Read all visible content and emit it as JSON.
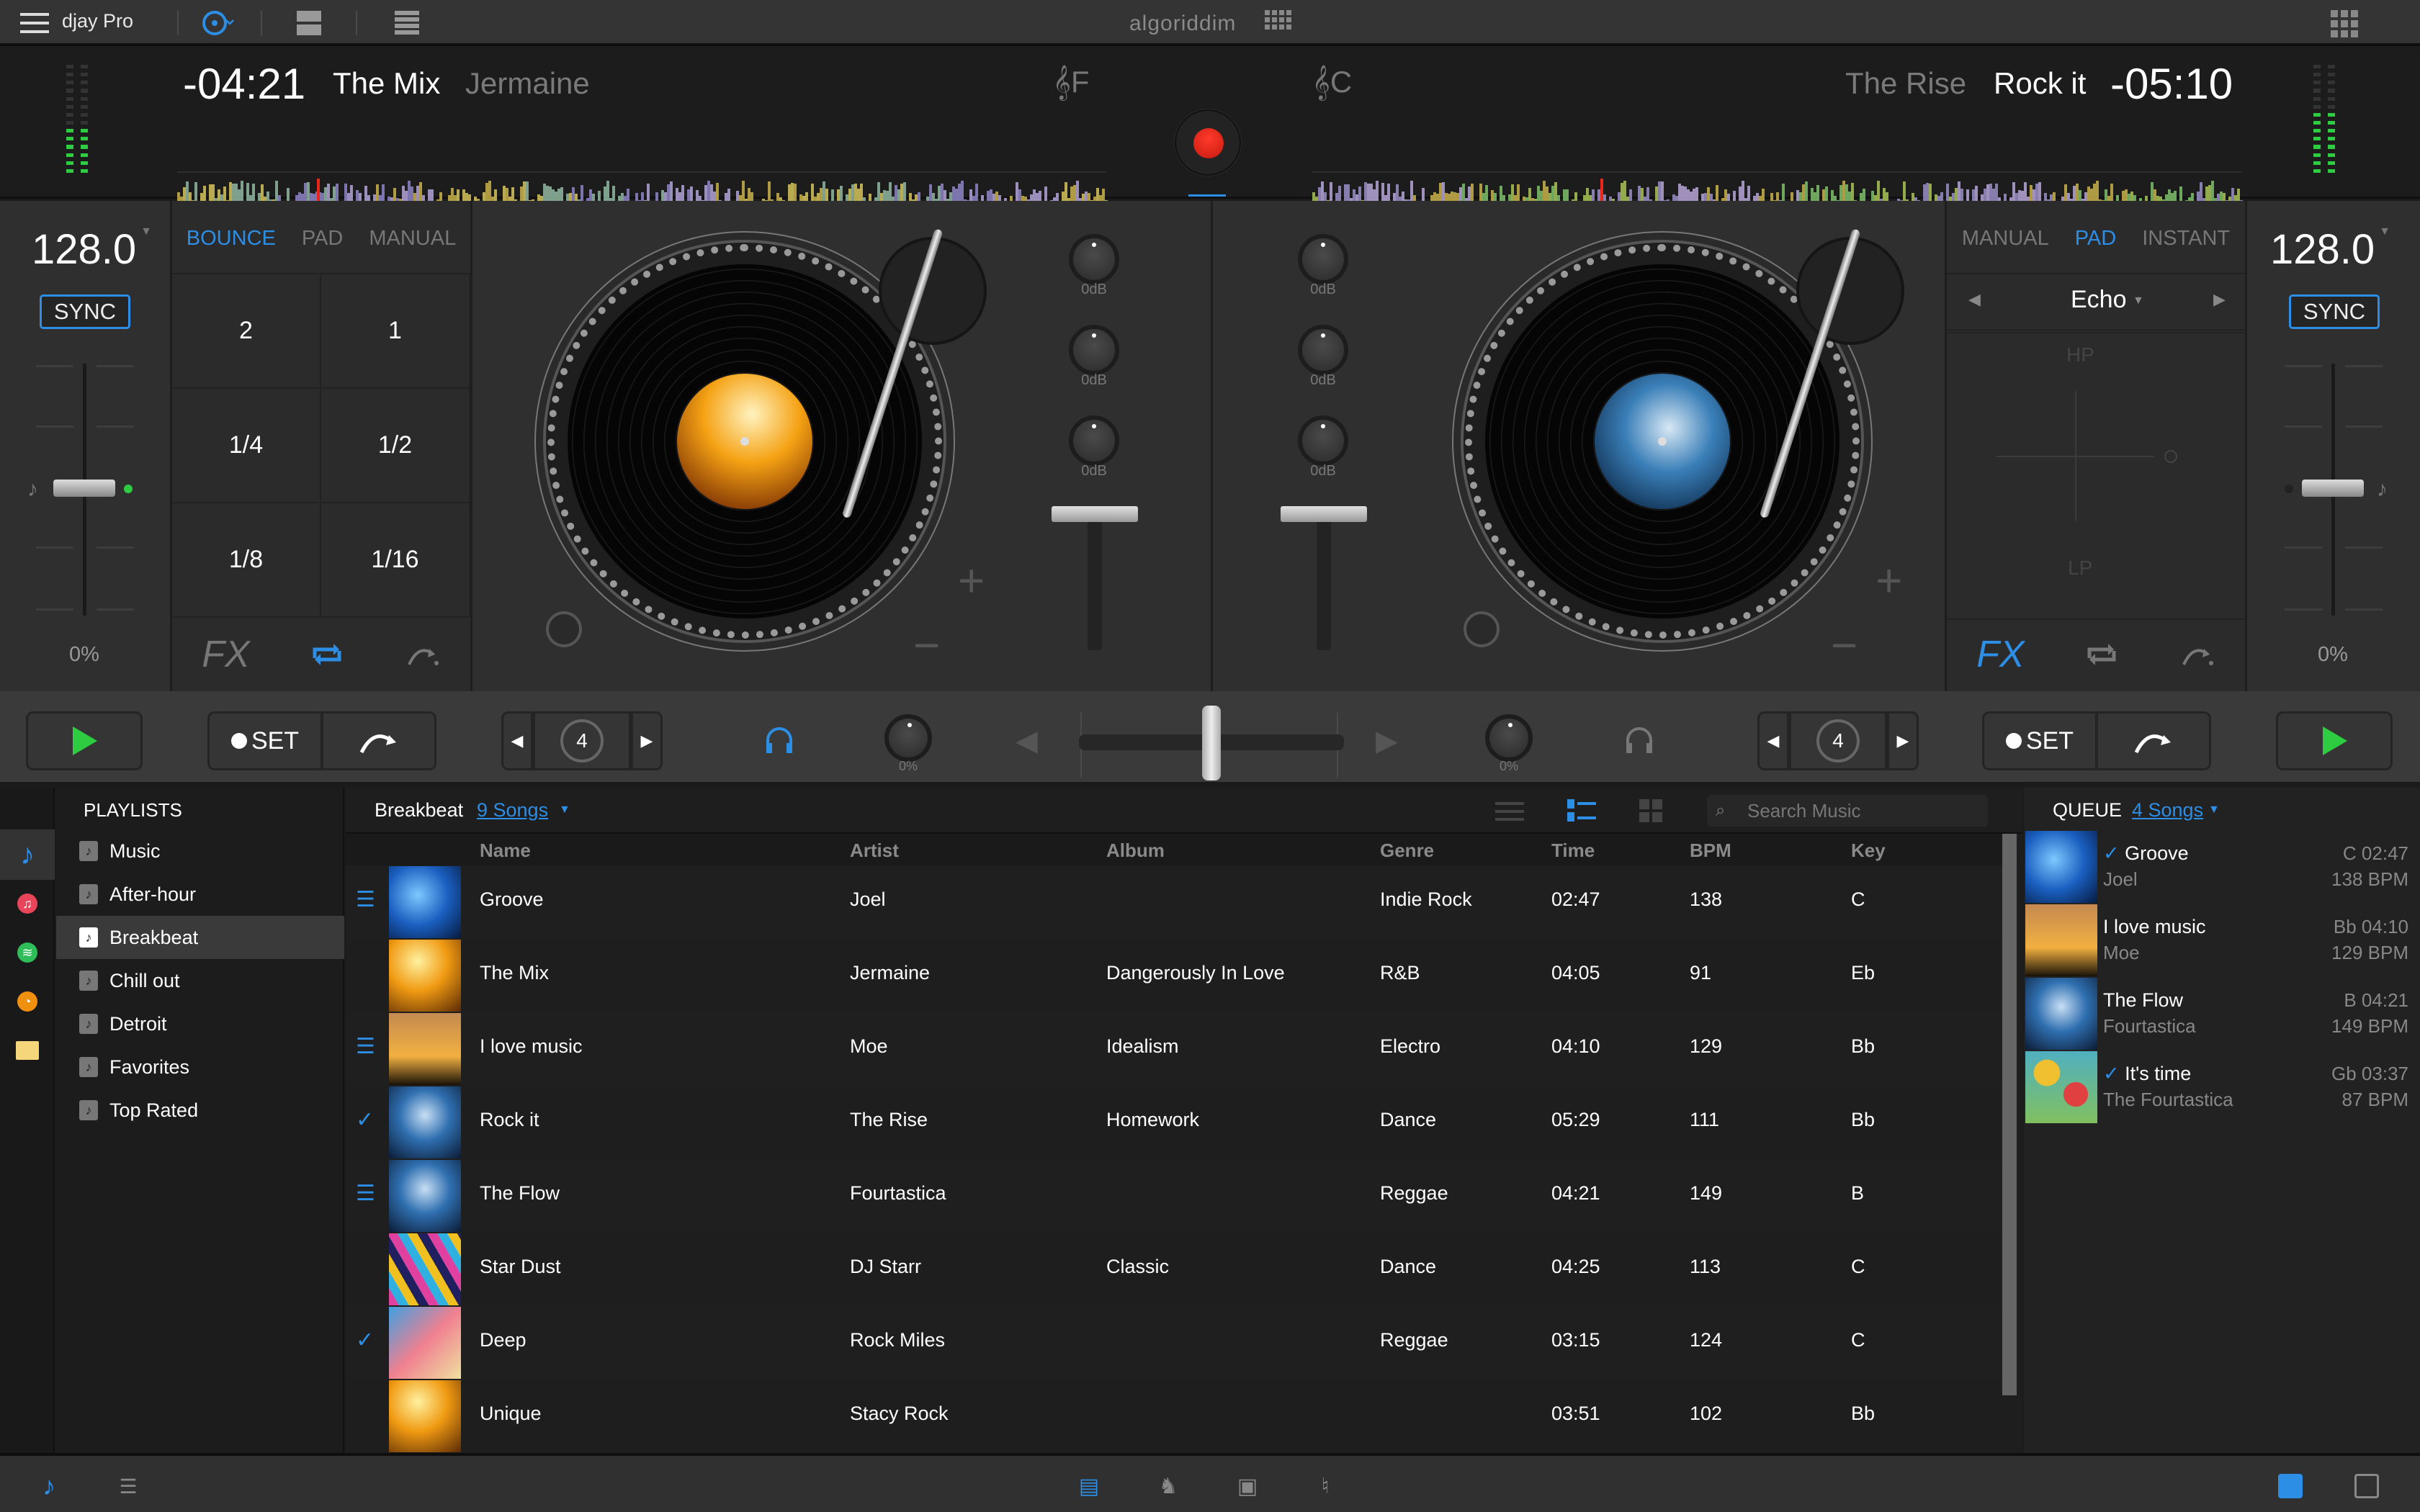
{
  "app": {
    "title": "djay Pro",
    "logo": "algoriddim"
  },
  "colors": {
    "accent": "#2d8ee6",
    "play": "#2ecc40",
    "record": "#e8261a",
    "vu_on": "#2ecc40"
  },
  "deck_left": {
    "time_remaining": "-04:21",
    "track": "The Mix",
    "artist": "Jermaine",
    "key": "F",
    "key_icon": "treble-clef-icon",
    "bpm": "128.0",
    "sync_label": "SYNC",
    "pitch_percent": "0%",
    "loop_tabs": [
      "BOUNCE",
      "PAD",
      "MANUAL"
    ],
    "loop_tab_active": "BOUNCE",
    "pads": [
      "2",
      "1",
      "1/4",
      "1/2",
      "1/8",
      "1/16"
    ],
    "fx_label": "FX",
    "eq": [
      "0dB",
      "0dB",
      "0dB"
    ],
    "gain_percent": "0%",
    "loop_count": "4",
    "set_label": "SET",
    "vu_level": 0.45,
    "playhead_position": 0.15
  },
  "deck_right": {
    "time_remaining": "-05:10",
    "track": "Rock it",
    "artist": "The Rise",
    "key": "C",
    "key_icon": "treble-clef-icon",
    "bpm": "128.0",
    "sync_label": "SYNC",
    "pitch_percent": "0%",
    "fx_tabs": [
      "MANUAL",
      "PAD",
      "INSTANT"
    ],
    "fx_tab_active": "PAD",
    "fx_name": "Echo",
    "xy_top": "HP",
    "xy_bottom": "LP",
    "fx_label": "FX",
    "eq": [
      "0dB",
      "0dB",
      "0dB"
    ],
    "gain_percent": "0%",
    "loop_count": "4",
    "set_label": "SET",
    "vu_level": 0.6,
    "playhead_position": 0.31
  },
  "crossfader": {
    "position": 0.5
  },
  "sources": [
    {
      "name": "music-icon",
      "active": true
    },
    {
      "name": "itunes-icon",
      "active": false
    },
    {
      "name": "spotify-icon",
      "active": false
    },
    {
      "name": "history-icon",
      "active": false
    },
    {
      "name": "folder-icon",
      "active": false
    }
  ],
  "playlists": {
    "header": "PLAYLISTS",
    "items": [
      "Music",
      "After-hour",
      "Breakbeat",
      "Chill out",
      "Detroit",
      "Favorites",
      "Top Rated"
    ],
    "selected": "Breakbeat"
  },
  "tracklist": {
    "playlist": "Breakbeat",
    "count_label": "9 Songs",
    "search_placeholder": "Search Music",
    "columns": [
      "Name",
      "Artist",
      "Album",
      "Genre",
      "Time",
      "BPM",
      "Key"
    ],
    "rows": [
      {
        "mark": "queued",
        "name": "Groove",
        "artist": "Joel",
        "album": "",
        "genre": "Indie Rock",
        "time": "02:47",
        "bpm": "138",
        "key": "C",
        "art": "blue"
      },
      {
        "mark": "",
        "name": "The Mix",
        "artist": "Jermaine",
        "album": "Dangerously In Love",
        "genre": "R&B",
        "time": "04:05",
        "bpm": "91",
        "key": "Eb",
        "art": "orange"
      },
      {
        "mark": "queued",
        "name": "I love music",
        "artist": "Moe",
        "album": "Idealism",
        "genre": "Electro",
        "time": "04:10",
        "bpm": "129",
        "key": "Bb",
        "art": "palms"
      },
      {
        "mark": "played",
        "name": "Rock it",
        "artist": "The Rise",
        "album": "Homework",
        "genre": "Dance",
        "time": "05:29",
        "bpm": "111",
        "key": "Bb",
        "art": "dancer"
      },
      {
        "mark": "queued",
        "name": "The Flow",
        "artist": "Fourtastica",
        "album": "",
        "genre": "Reggae",
        "time": "04:21",
        "bpm": "149",
        "key": "B",
        "art": "dancer"
      },
      {
        "mark": "",
        "name": "Star Dust",
        "artist": "DJ Starr",
        "album": "Classic",
        "genre": "Dance",
        "time": "04:25",
        "bpm": "113",
        "key": "C",
        "art": "triangles"
      },
      {
        "mark": "played",
        "name": "Deep",
        "artist": "Rock Miles",
        "album": "",
        "genre": "Reggae",
        "time": "03:15",
        "bpm": "124",
        "key": "C",
        "art": "pyramid"
      },
      {
        "mark": "",
        "name": "Unique",
        "artist": "Stacy Rock",
        "album": "",
        "genre": "",
        "time": "03:51",
        "bpm": "102",
        "key": "Bb",
        "art": "orange"
      }
    ]
  },
  "queue": {
    "header": "QUEUE",
    "count_label": "4 Songs",
    "items": [
      {
        "played": true,
        "title": "Groove",
        "artist": "Joel",
        "key_time": "C 02:47",
        "bpm": "138 BPM",
        "art": "blue"
      },
      {
        "played": false,
        "title": "I love music",
        "artist": "Moe",
        "key_time": "Bb 04:10",
        "bpm": "129 BPM",
        "art": "palms"
      },
      {
        "played": false,
        "title": "The Flow",
        "artist": "Fourtastica",
        "key_time": "B 04:21",
        "bpm": "149 BPM",
        "art": "dancer"
      },
      {
        "played": true,
        "title": "It's time",
        "artist": "The Fourtastica",
        "key_time": "Gb 03:37",
        "bpm": "87 BPM",
        "art": "dots"
      }
    ]
  }
}
